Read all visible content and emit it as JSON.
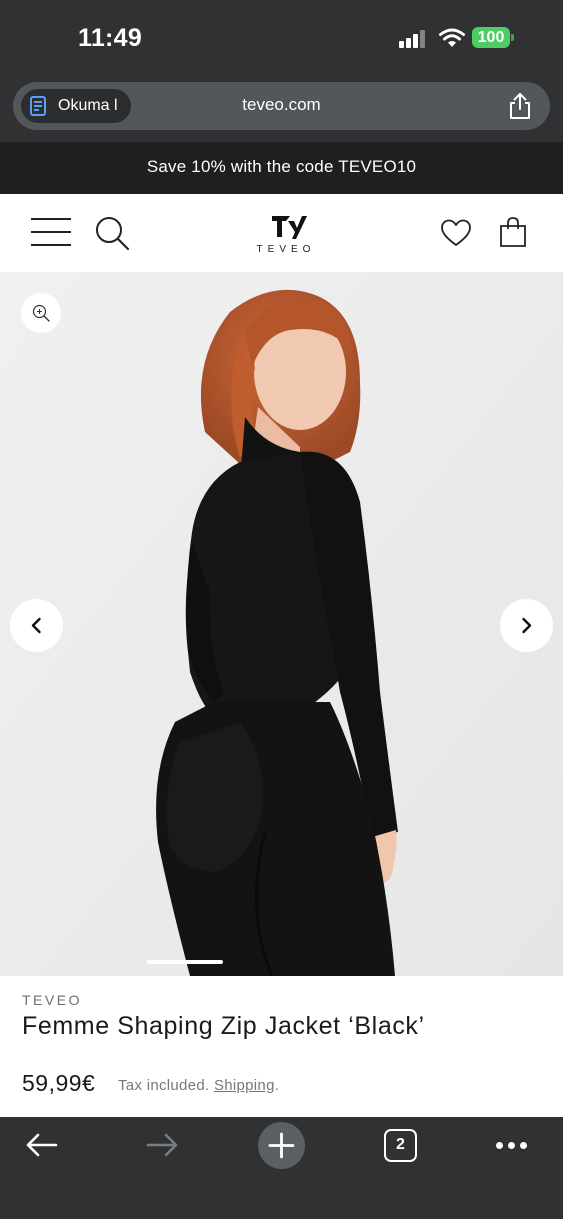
{
  "status_bar": {
    "time": "11:49",
    "battery": "100",
    "battery_color": "#4ccd62"
  },
  "browser": {
    "tab_label": "Okuma l",
    "url": "teveo.com",
    "icons": [
      "reader-icon",
      "share-icon"
    ]
  },
  "promo": {
    "text": "Save 10% with the code TEVEO10"
  },
  "header": {
    "logo_word": "TEVEO",
    "icons": [
      "menu-icon",
      "search-icon",
      "heart-icon",
      "bag-icon"
    ]
  },
  "gallery": {
    "image_alt": "Model wearing Femme Shaping Zip Jacket Black",
    "icons": [
      "zoom-in-icon",
      "chevron-left-icon",
      "chevron-right-icon"
    ]
  },
  "product": {
    "vendor": "TEVEO",
    "title": "Femme Shaping Zip Jacket ‘Black’",
    "price": "59,99€",
    "tax_text": "Tax included.",
    "shipping_link": "Shipping",
    "tax_suffix": "."
  },
  "toolbar": {
    "tab_count": "2",
    "icons": [
      "back-arrow-icon",
      "forward-arrow-icon",
      "plus-icon",
      "tabs-icon",
      "more-icon"
    ]
  }
}
